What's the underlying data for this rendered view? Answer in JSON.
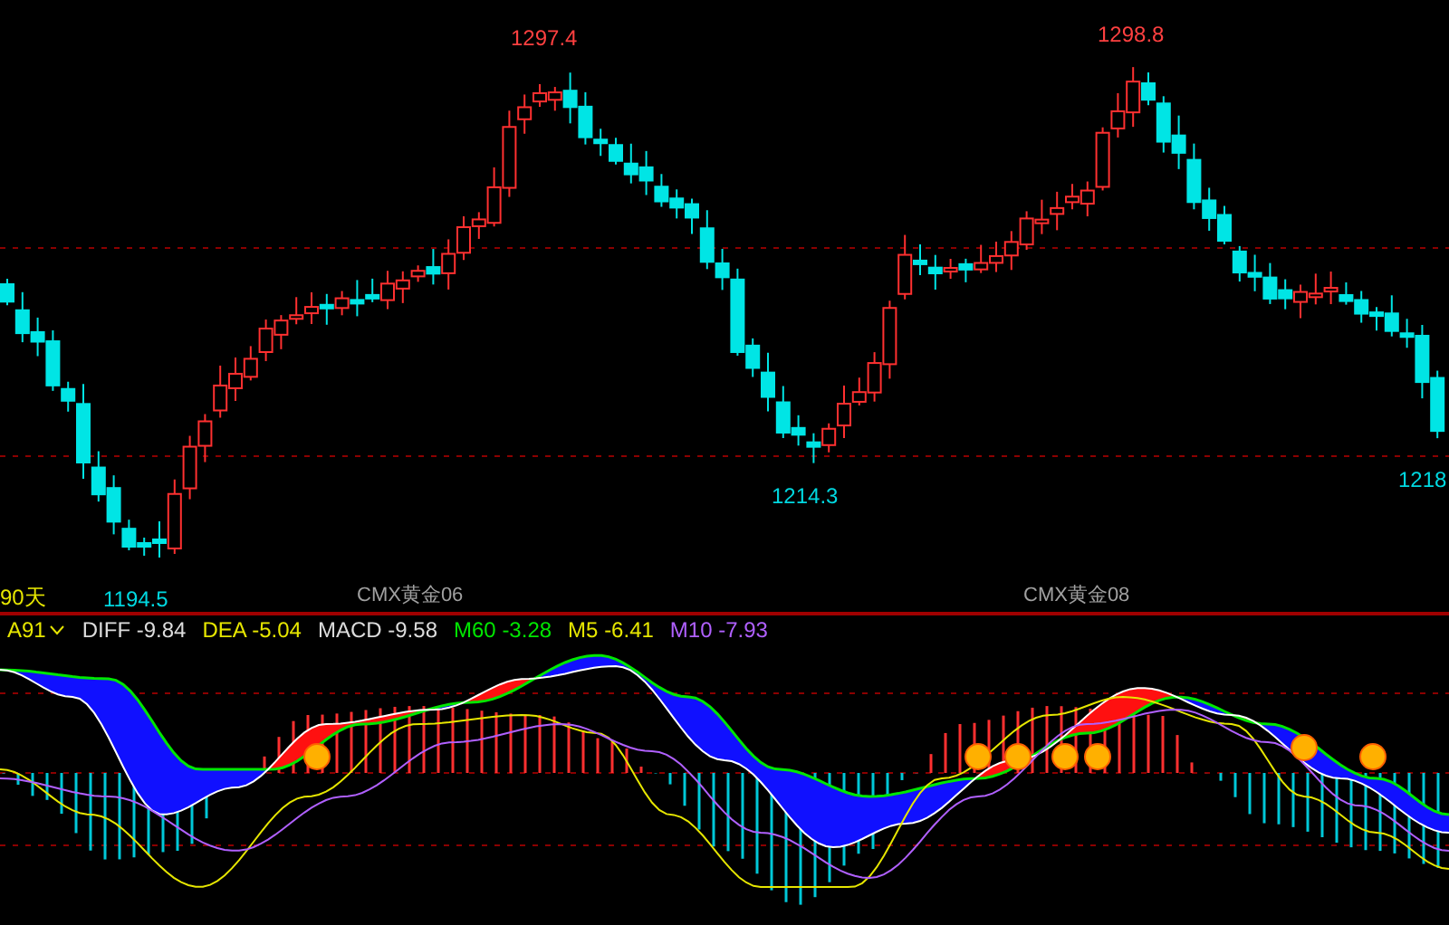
{
  "price_chart": {
    "period_label": "90天",
    "price_labels": [
      {
        "text": "1297.4",
        "kind": "high"
      },
      {
        "text": "1298.8",
        "kind": "high"
      },
      {
        "text": "1214.3",
        "kind": "low"
      },
      {
        "text": "1218",
        "kind": "low"
      },
      {
        "text": "1194.5",
        "kind": "low"
      }
    ],
    "contract_labels": [
      "CMX黄金06",
      "CMX黄金08"
    ]
  },
  "indicator": {
    "selector": "A91",
    "values": [
      {
        "name": "DIFF",
        "value": "-9.84",
        "color": "#dcdcdc"
      },
      {
        "name": "DEA",
        "value": "-5.04",
        "color": "#e6e600"
      },
      {
        "name": "MACD",
        "value": "-9.58",
        "color": "#dcdcdc"
      },
      {
        "name": "M60",
        "value": "-3.28",
        "color": "#00e600"
      },
      {
        "name": "M5",
        "value": "-6.41",
        "color": "#e6e600"
      },
      {
        "name": "M10",
        "value": "-7.93",
        "color": "#b060ff"
      }
    ]
  }
}
